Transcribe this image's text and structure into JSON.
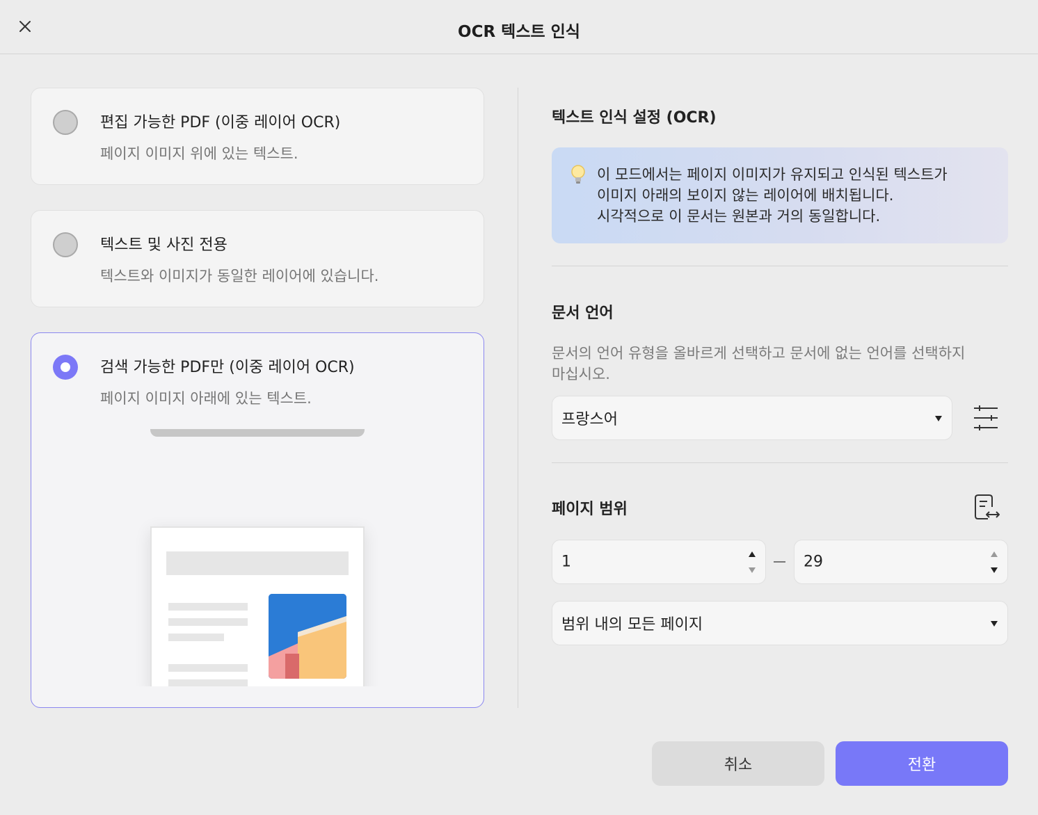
{
  "header": {
    "title": "OCR 텍스트 인식"
  },
  "options": [
    {
      "title": "편집 가능한 PDF (이중 레이어 OCR)",
      "description": "페이지 이미지 위에 있는 텍스트.",
      "selected": false
    },
    {
      "title": "텍스트 및 사진 전용",
      "description": "텍스트와 이미지가 동일한 레이어에 있습니다.",
      "selected": false
    },
    {
      "title": "검색 가능한 PDF만 (이중 레이어 OCR)",
      "description": "페이지 이미지 아래에 있는 텍스트.",
      "selected": true
    }
  ],
  "settings": {
    "title": "텍스트 인식 설정 (OCR)",
    "info_lines": [
      "이 모드에서는 페이지 이미지가 유지되고 인식된 텍스트가",
      "이미지 아래의 보이지 않는 레이어에 배치됩니다.",
      "시각적으로 이 문서는 원본과 거의 동일합니다."
    ]
  },
  "language": {
    "title": "문서 언어",
    "description": "문서의 언어 유형을 올바르게 선택하고 문서에 없는 언어를 선택하지 마십시오.",
    "selected": "프랑스어"
  },
  "page_range": {
    "title": "페이지 범위",
    "from": "1",
    "to": "29",
    "subset": "범위 내의 모든 페이지"
  },
  "buttons": {
    "cancel": "취소",
    "convert": "전환"
  },
  "colors": {
    "accent": "#7878f8",
    "selected_border": "#8b87f0",
    "background": "#ececec"
  },
  "icons": {
    "close": "close-icon",
    "bulb": "lightbulb-icon",
    "settings": "sliders-icon",
    "page_range": "page-swap-icon",
    "dropdown": "chevron-down-icon"
  }
}
